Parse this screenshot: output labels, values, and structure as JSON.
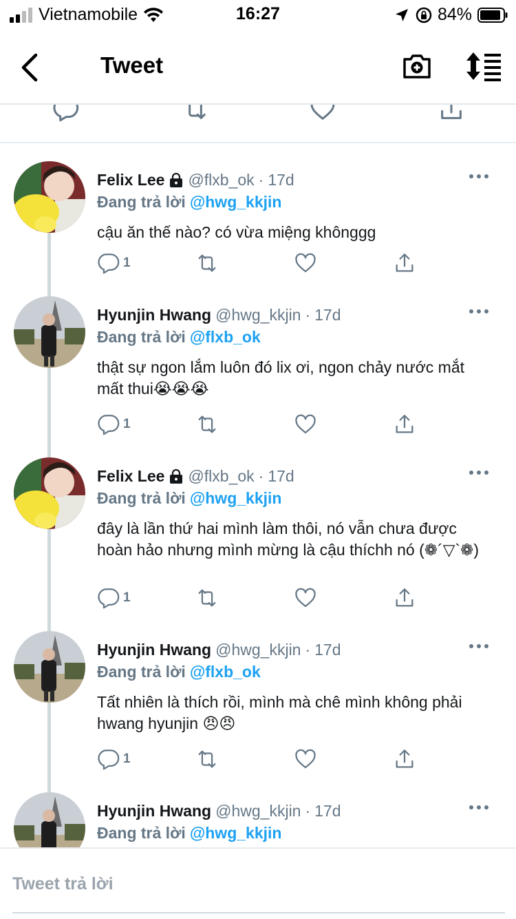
{
  "status_bar": {
    "carrier": "Vietnamobile",
    "time": "16:27",
    "battery": "84%"
  },
  "header": {
    "title": "Tweet"
  },
  "tweets": [
    {
      "name": "Felix Lee",
      "handle": "@flxb_ok",
      "separator": "·",
      "time": "17d",
      "protected": true,
      "reply_label": "Đang trả lời",
      "reply_to": "@hwg_kkjin",
      "text": "cậu ăn thế nào? có vừa miệng khônggg",
      "reply_count": "1"
    },
    {
      "name": "Hyunjin Hwang",
      "handle": "@hwg_kkjin",
      "separator": "·",
      "time": "17d",
      "protected": false,
      "reply_label": "Đang trả lời",
      "reply_to": "@flxb_ok",
      "text": "thật sự ngon lắm luôn đó lix ơi, ngon chảy nước mắt mất thui😭😭😭",
      "reply_count": "1"
    },
    {
      "name": "Felix Lee",
      "handle": "@flxb_ok",
      "separator": "·",
      "time": "17d",
      "protected": true,
      "reply_label": "Đang trả lời",
      "reply_to": "@hwg_kkjin",
      "text": "đây là lần thứ hai mình làm thôi, nó vẫn chưa được hoàn hảo nhưng mình mừng là cậu thíchh nó (❁´▽`❁)",
      "reply_count": "1"
    },
    {
      "name": "Hyunjin Hwang",
      "handle": "@hwg_kkjin",
      "separator": "·",
      "time": "17d",
      "protected": false,
      "reply_label": "Đang trả lời",
      "reply_to": "@flxb_ok",
      "text": "Tất nhiên là thích rồi, mình mà chê mình không phải hwang hyunjin 😠😠",
      "reply_count": "1"
    },
    {
      "name": "Hyunjin Hwang",
      "handle": "@hwg_kkjin",
      "separator": "·",
      "time": "17d",
      "protected": false,
      "reply_label": "Đang trả lời",
      "reply_to": "@hwg_kkjin",
      "text": "",
      "reply_count": ""
    }
  ],
  "composer": {
    "placeholder": "Tweet trả lời"
  },
  "colors": {
    "accent": "#1da1f2",
    "text": "#14171a",
    "secondary": "#657786",
    "divider": "#e6ecf0"
  }
}
